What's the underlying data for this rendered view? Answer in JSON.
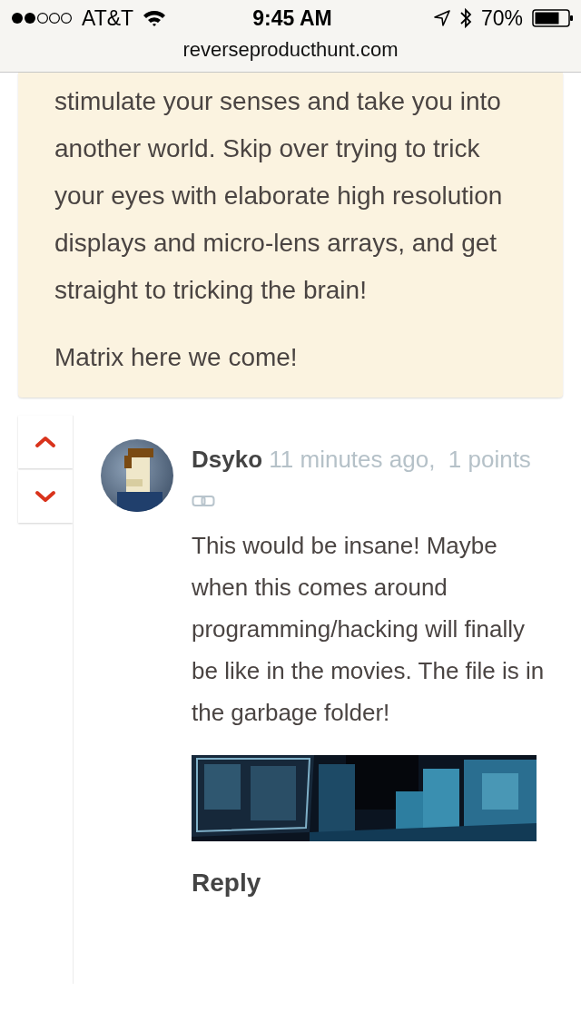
{
  "status_bar": {
    "carrier": "AT&T",
    "time": "9:45 AM",
    "battery": "70%"
  },
  "address_bar": {
    "url": "reverseproducthunt.com"
  },
  "post": {
    "paragraphs": [
      "stimulate your senses and take you into another world. Skip over trying to trick your eyes with elaborate high resolution displays and micro-lens arrays, and get straight to tricking the brain!",
      "Matrix here we come!"
    ]
  },
  "comment": {
    "author": "Dsyko",
    "meta": "11 minutes ago,  1 points",
    "body": "This would be insane! Maybe when this comes around programming/hacking will finally be like in the movies. The file is in the garbage folder!",
    "reply": "Reply"
  }
}
